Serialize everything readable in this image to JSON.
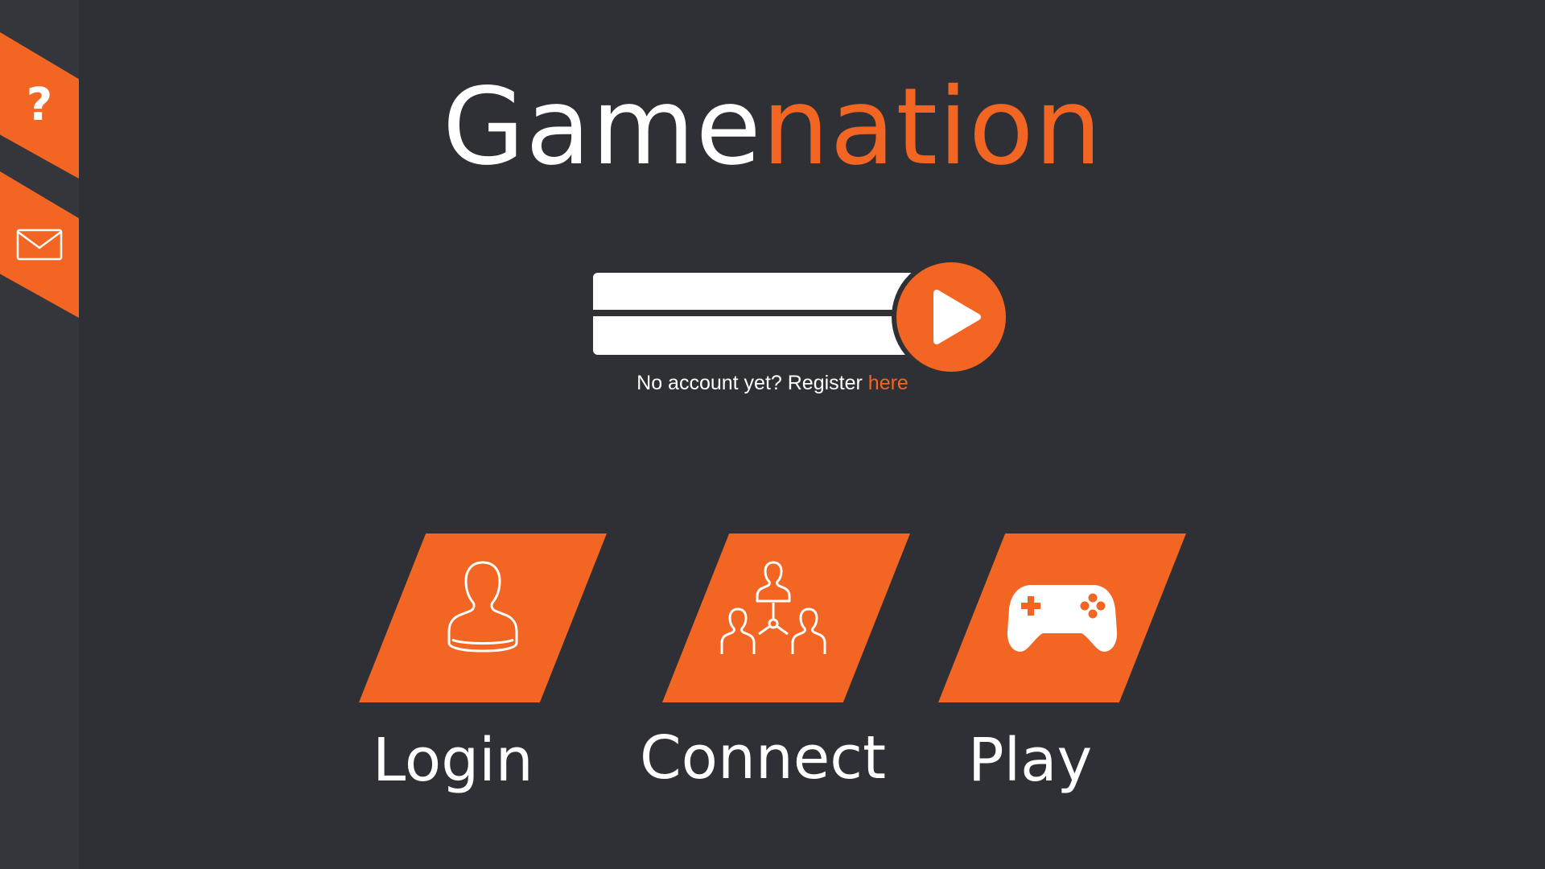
{
  "brand": {
    "title_part1": "Game",
    "title_part2": "nation"
  },
  "colors": {
    "accent": "#f26522",
    "background": "#2f3035",
    "sidebar": "#35363b",
    "text": "#ffffff"
  },
  "sidebar": {
    "items": [
      {
        "icon": "question-icon",
        "glyph": "?"
      },
      {
        "icon": "mail-icon"
      }
    ]
  },
  "login": {
    "username_value": "",
    "password_value": "",
    "submit_icon": "play-icon"
  },
  "register": {
    "text": "No account yet? Register ",
    "link": "here"
  },
  "tiles": [
    {
      "label": "Login",
      "icon": "user-icon"
    },
    {
      "label": "Connect",
      "icon": "network-users-icon"
    },
    {
      "label": "Play",
      "icon": "gamepad-icon"
    }
  ]
}
